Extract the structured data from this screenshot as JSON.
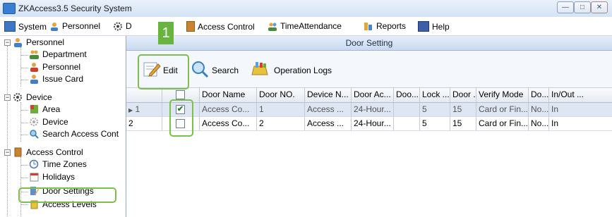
{
  "window": {
    "title": "ZKAccess3.5 Security System"
  },
  "menubar": {
    "items": [
      "System",
      "Personnel",
      "Device",
      "Access Control",
      "TimeAttendance",
      "Reports",
      "Help"
    ],
    "device_visible_prefix": "D"
  },
  "tree": {
    "personnel": "Personnel",
    "personnel_children": [
      "Department",
      "Personnel",
      "Issue Card"
    ],
    "device": "Device",
    "device_children": [
      "Area",
      "Device",
      "Search Access Cont"
    ],
    "access_control": "Access Control",
    "access_control_children": [
      "Time Zones",
      "Holidays",
      "Door Settings",
      "Access Levels"
    ]
  },
  "panel": {
    "title": "Door Setting"
  },
  "toolbar": {
    "edit": "Edit",
    "search": "Search",
    "operation_logs": "Operation Logs"
  },
  "annotation": {
    "step": "1",
    "color": "#69b33f"
  },
  "grid": {
    "columns": [
      "Door Name",
      "Door NO.",
      "Device N...",
      "Door Ac...",
      "Doo...",
      "Lock ...",
      "Door ...",
      "Verify Mode",
      "Do...",
      "In/Out ..."
    ],
    "rows": [
      {
        "num": "1",
        "checked": true,
        "cells": [
          "Access Co...",
          "1",
          "Access ...",
          "24-Hour...",
          "",
          "5",
          "15",
          "Card or Fin...",
          "No...",
          "In"
        ]
      },
      {
        "num": "2",
        "checked": false,
        "cells": [
          "Access Co...",
          "2",
          "Access ...",
          "24-Hour...",
          "",
          "5",
          "15",
          "Card or Fin...",
          "No...",
          "In"
        ]
      }
    ]
  }
}
